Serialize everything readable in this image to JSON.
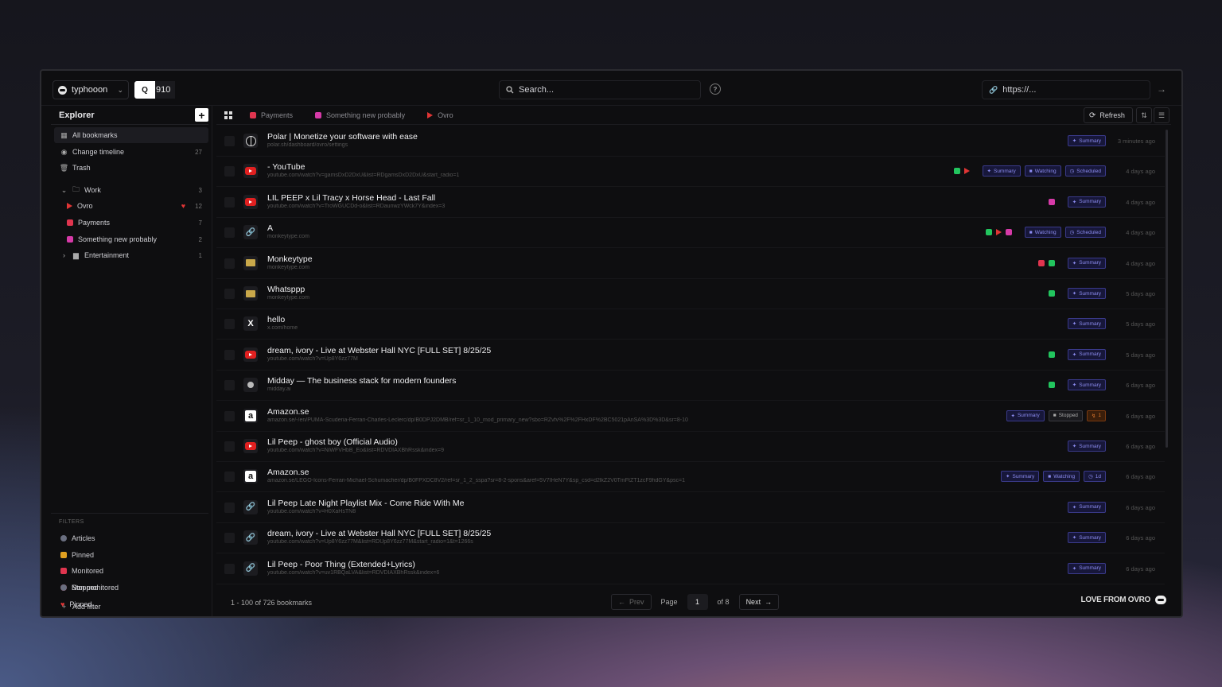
{
  "header": {
    "workspace": "typhooon",
    "shortcut_key": "Q",
    "shortcut_num": "910",
    "search_placeholder": "Search...",
    "url_placeholder": "https://..."
  },
  "sidebar": {
    "title": "Explorer",
    "items": [
      {
        "label": "All bookmarks",
        "count": "",
        "icon": "grid-icon"
      },
      {
        "label": "Change timeline",
        "count": "27",
        "icon": "eye-icon"
      },
      {
        "label": "Trash",
        "count": "",
        "icon": "trash-icon"
      }
    ],
    "folders": [
      {
        "label": "Work",
        "count": "3",
        "icon": "folder-icon"
      },
      {
        "label": "Ovro",
        "count": "12",
        "color": "#e03535",
        "icon": "play-icon"
      },
      {
        "label": "Payments",
        "count": "7",
        "color": "#e0354f",
        "icon": "card-icon"
      },
      {
        "label": "Something new probably",
        "count": "2",
        "color": "#d63aa8",
        "icon": "cube-icon"
      },
      {
        "label": "Entertainment",
        "count": "1",
        "icon": "folder-icon"
      }
    ],
    "filters_label": "FILTERS",
    "filters": [
      {
        "label": "Articles",
        "color": "#6a6f80"
      },
      {
        "label": "Pinned",
        "color": "#e0a020"
      },
      {
        "label": "Monitored",
        "color": "#e0354f"
      },
      {
        "label": "Stopped",
        "color": "#e03545"
      },
      {
        "label": "Pinned",
        "color": "#e03535"
      },
      {
        "label": "Non monitored",
        "color": "#6a6f80"
      }
    ],
    "add_filter": "Add filter"
  },
  "tabs": [
    {
      "label": "Payments",
      "color": "#e0354f"
    },
    {
      "label": "Something new probably",
      "color": "#d63aa8"
    },
    {
      "label": "Ovro",
      "color": "#e03535"
    }
  ],
  "toolbar": {
    "refresh": "Refresh"
  },
  "bookmarks": [
    {
      "title": "Polar | Monetize your software with ease",
      "url": "polar.sh/dashboard/ovro/settings",
      "time": "3 minutes ago",
      "fav": "polar",
      "tags": [
        "Summary"
      ]
    },
    {
      "title": "- YouTube",
      "url": "youtube.com/watch?v=gamsDxD2DxU&list=RDgamsDxD2DxU&start_radio=1",
      "time": "4 days ago",
      "fav": "yt",
      "marks": [
        "green",
        "tri"
      ],
      "tags": [
        "Summary",
        "Watching",
        "Scheduled"
      ]
    },
    {
      "title": "LIL PEEP x Lil Tracy x Horse Head - Last Fall",
      "url": "youtube.com/watch?v=TroWGUCDd-o&list=RDaunwzYWck7Y&index=3",
      "time": "4 days ago",
      "fav": "yt",
      "marks": [
        "pink"
      ],
      "tags": [
        "Summary"
      ]
    },
    {
      "title": "A",
      "url": "monkeytype.com",
      "time": "4 days ago",
      "fav": "link",
      "marks": [
        "green",
        "tri",
        "pink"
      ],
      "tags": [
        "Watching",
        "Scheduled"
      ]
    },
    {
      "title": "Monkeytype",
      "url": "monkeytype.com",
      "time": "4 days ago",
      "fav": "kbd",
      "marks": [
        "red",
        "green"
      ],
      "tags": [
        "Summary"
      ]
    },
    {
      "title": "Whatsppp",
      "url": "monkeytype.com",
      "time": "5 days ago",
      "fav": "kbd",
      "marks": [
        "green"
      ],
      "tags": [
        "Summary"
      ]
    },
    {
      "title": "hello",
      "url": "x.com/home",
      "time": "5 days ago",
      "fav": "x",
      "tags": [
        "Summary"
      ]
    },
    {
      "title": "dream, ivory - Live at Webster Hall NYC [FULL SET] 8/25/25",
      "url": "youtube.com/watch?v=Up8Y6zz77M",
      "time": "5 days ago",
      "fav": "yt",
      "marks": [
        "green"
      ],
      "tags": [
        "Summary"
      ]
    },
    {
      "title": "Midday — The business stack for modern founders",
      "url": "midday.ai",
      "time": "6 days ago",
      "fav": "midday",
      "marks": [
        "green"
      ],
      "tags": [
        "Summary"
      ]
    },
    {
      "title": "Amazon.se",
      "url": "amazon.se/-/en/PUMA-Scuderia-Ferrari-Charles-Leclerc/dp/B0DPJ2DMB/ref=sr_1_10_mod_primary_new?sbo=RZvfv%2F%2FHxDF%2BC5021pAnSA%3D%3D&sr=8-10",
      "time": "6 days ago",
      "fav": "amazon",
      "tags": [
        "Summary",
        "Stopped",
        "1"
      ]
    },
    {
      "title": "Lil Peep - ghost boy (Official Audio)",
      "url": "youtube.com/watch?v=NiWFVHbB_Eo&list=RDVDIAXBhRssk&index=9",
      "time": "6 days ago",
      "fav": "yt",
      "tags": [
        "Summary"
      ]
    },
    {
      "title": "Amazon.se",
      "url": "amazon.se/LEGO-Icons-Ferrari-Michael-Schumacher/dp/B0FPXDC8V2/ref=sr_1_2_sspa?sr=8-2-spons&aref=5V7IHeN7Y&sp_csd=d2lkZ2V0TmFtZT1zcF9hdGY&psc=1",
      "time": "6 days ago",
      "fav": "amazon",
      "tags": [
        "Summary",
        "Watching",
        "1d"
      ]
    },
    {
      "title": "Lil Peep Late Night Playlist Mix - Come Ride With Me",
      "url": "youtube.com/watch?v=H0XaHsTN8",
      "time": "6 days ago",
      "fav": "link",
      "tags": [
        "Summary"
      ]
    },
    {
      "title": "dream, ivory - Live at Webster Hall NYC [FULL SET] 8/25/25",
      "url": "youtube.com/watch?v=Up8Y6zz77M&list=RDUp8Y6zz77M&start_radio=1&t=1266s",
      "time": "6 days ago",
      "fav": "link",
      "tags": [
        "Summary"
      ]
    },
    {
      "title": "Lil Peep - Poor Thing (Extended+Lyrics)",
      "url": "youtube.com/watch?v=uv1RBQaLVA&list=RDVDIAXBhRssk&index=6",
      "time": "6 days ago",
      "fav": "link",
      "tags": [
        "Summary"
      ]
    }
  ],
  "footer": {
    "range": "1 - 100 of 726 bookmarks",
    "prev": "Prev",
    "page_label": "Page",
    "page": "1",
    "of": "of 8",
    "next": "Next",
    "brand": "LOVE FROM OVRO"
  }
}
